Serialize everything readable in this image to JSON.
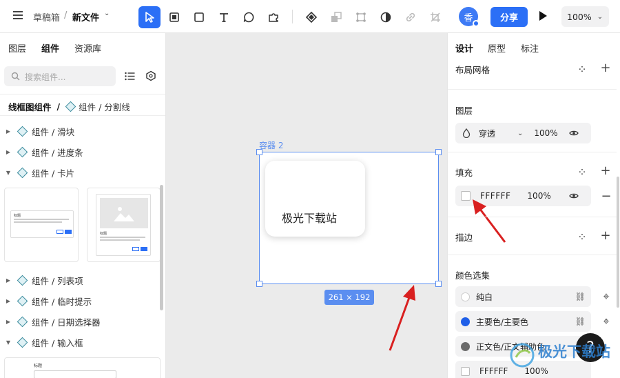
{
  "topbar": {
    "breadcrumb_parent": "草稿箱",
    "breadcrumb_sep": "/",
    "file_name": "新文件",
    "avatar_text": "香",
    "share_label": "分享",
    "zoom": "100%"
  },
  "left_panel": {
    "tabs": [
      "图层",
      "组件",
      "资源库"
    ],
    "search_placeholder": "搜索组件...",
    "path_root": "线框图组件",
    "path_sep": "/",
    "path_current": "组件 / 分割线",
    "tree": [
      {
        "label": "组件 / 滑块",
        "expanded": false
      },
      {
        "label": "组件 / 进度条",
        "expanded": false
      },
      {
        "label": "组件 / 卡片",
        "expanded": true
      },
      {
        "label": "组件 / 列表项",
        "expanded": false
      },
      {
        "label": "组件 / 临时提示",
        "expanded": false
      },
      {
        "label": "组件 / 日期选择器",
        "expanded": false
      },
      {
        "label": "组件 / 输入框",
        "expanded": true
      }
    ],
    "card_preview_1": {
      "title": "标题"
    },
    "card_preview_2": {
      "title": "标题"
    },
    "input_preview_title": "标题"
  },
  "canvas": {
    "frame_label": "容器 2",
    "card_text": "极光下载站",
    "size_badge": "261 × 192"
  },
  "right_panel": {
    "tabs": [
      "设计",
      "原型",
      "标注"
    ],
    "layout_grid": "布局网格",
    "layer_title": "图层",
    "blend_mode": "穿透",
    "layer_opacity": "100%",
    "fill_title": "填充",
    "fill_hex": "FFFFFF",
    "fill_opacity": "100%",
    "stroke_title": "描边",
    "color_section": "颜色选集",
    "colors": [
      {
        "name": "纯白",
        "swatch": "#ffffff"
      },
      {
        "name": "主要色/主要色",
        "swatch": "#1f5fe8"
      },
      {
        "name": "正文色/正文辅助色",
        "swatch": "#6b6b6b"
      }
    ],
    "bottom_hex": "FFFFFF",
    "bottom_opacity": "100%"
  },
  "help": {
    "label": "?"
  },
  "watermark": {
    "text": "极光下载站"
  },
  "colors": {
    "accent": "#2b6ff6",
    "selection": "#5b8ef0",
    "arrow": "#d92020"
  }
}
